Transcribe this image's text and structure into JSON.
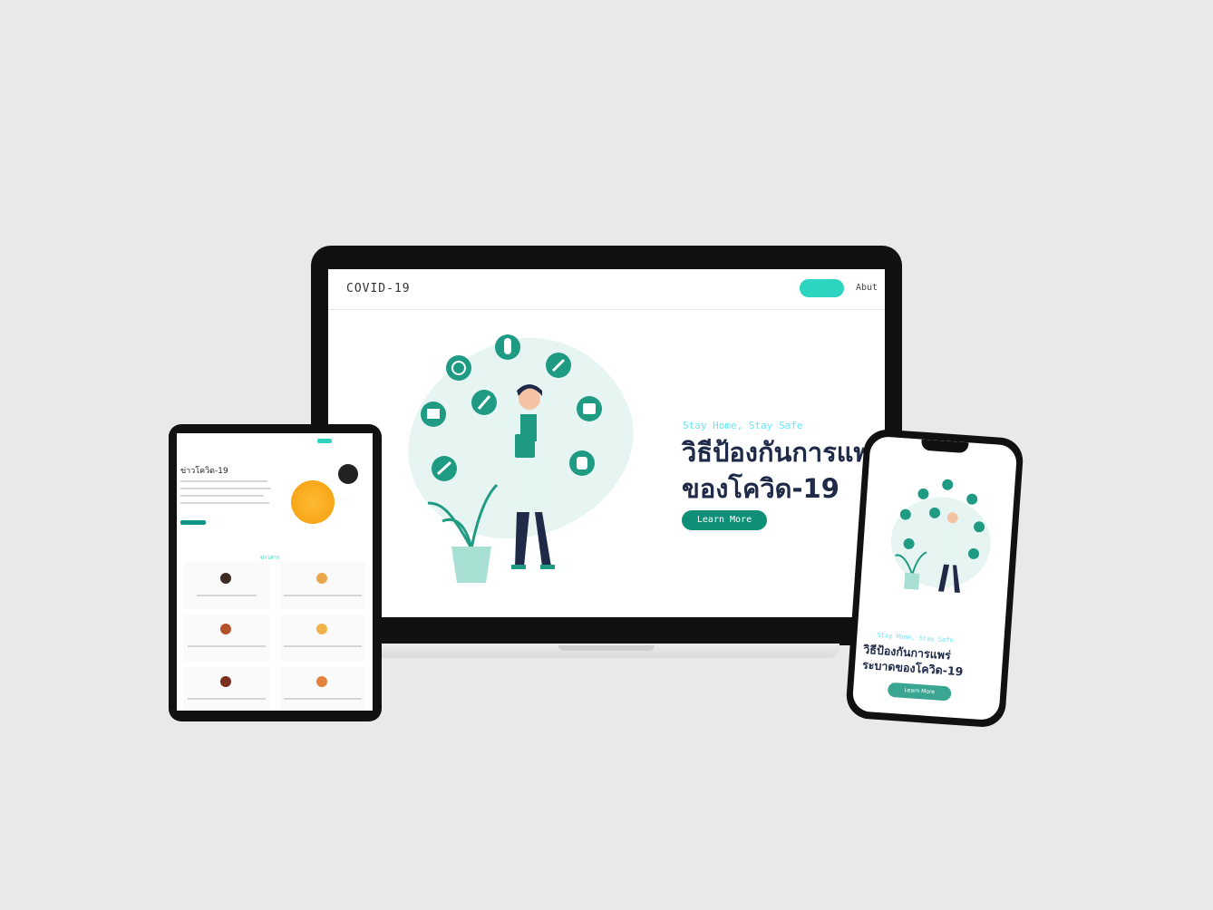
{
  "brand": {
    "accent": "#0f8f76",
    "accent_light": "#2dd4bf",
    "tag_color": "#67e8f9",
    "title_color": "#1e2a47"
  },
  "laptop": {
    "nav": {
      "logo": "COVID-19",
      "button_label": "",
      "link": "Abut"
    },
    "hero": {
      "tagline": "Stay Home, Stay Safe",
      "title_line1": "วิธีป้องกันการแพ",
      "title_line2": "ของโควิด-19",
      "cta": "Learn More"
    }
  },
  "tablet": {
    "title": "ข่าวโควิด-19",
    "section_label": "ข่าวสาร"
  },
  "phone": {
    "tagline": "Stay Home, Stay Safe",
    "title_line1": "วิธีป้องกันการแพร่",
    "title_line2": "ระบาดของโควิด-19",
    "cta": "Learn More"
  },
  "icons": [
    "pill-icon",
    "thermometer-icon",
    "mask-icon",
    "sanitizer-icon",
    "syringe-icon",
    "soap-icon",
    "virus-icon",
    "plant-icon"
  ]
}
